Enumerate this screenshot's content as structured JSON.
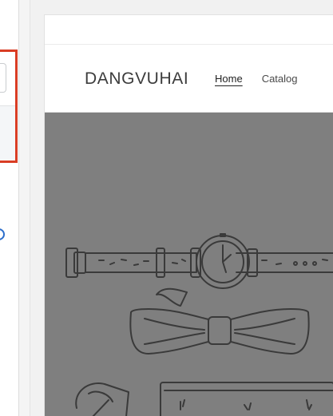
{
  "store": {
    "logo": "DANGVUHAI",
    "nav": [
      {
        "label": "Home",
        "active": true
      },
      {
        "label": "Catalog",
        "active": false
      }
    ]
  },
  "hero": {
    "image": "watch-belt-bowtie-illustration"
  },
  "colors": {
    "highlight": "#d93d24",
    "hero_background": "#7f7f7f",
    "radio_accent": "#2c6ecb"
  }
}
